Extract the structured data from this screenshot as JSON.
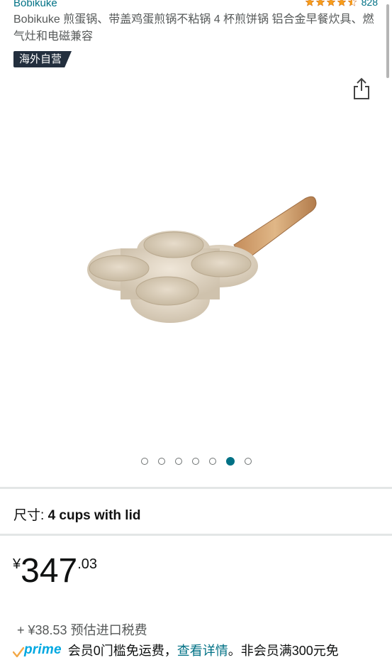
{
  "header": {
    "brand": "Bobikuke",
    "rating_count": "828",
    "stars": 4.5,
    "title": "Bobikuke 煎蛋锅、带盖鸡蛋煎锅不粘锅 4 杯煎饼锅 铝合金早餐炊具、燃气灶和电磁兼容",
    "badge": "海外自营",
    "share_icon": "share-icon"
  },
  "gallery": {
    "image_count": 7,
    "active_index": 5
  },
  "options": {
    "size_label": "尺寸:",
    "size_value": "4 cups with lid"
  },
  "price": {
    "symbol": "¥",
    "whole": "347",
    "fraction": ".03"
  },
  "tax": {
    "text": "+ ¥38.53 预估进口税费"
  },
  "prime": {
    "logo_text": "prime",
    "text_before": "会员0门槛免运费，",
    "link_text": "查看详情",
    "text_after": "。非会员满300元免"
  },
  "colors": {
    "link": "#007185",
    "star": "#f79e1b",
    "badge_bg": "#232f3e",
    "prime_blue": "#00a8e1",
    "prime_check": "#f3a847"
  }
}
